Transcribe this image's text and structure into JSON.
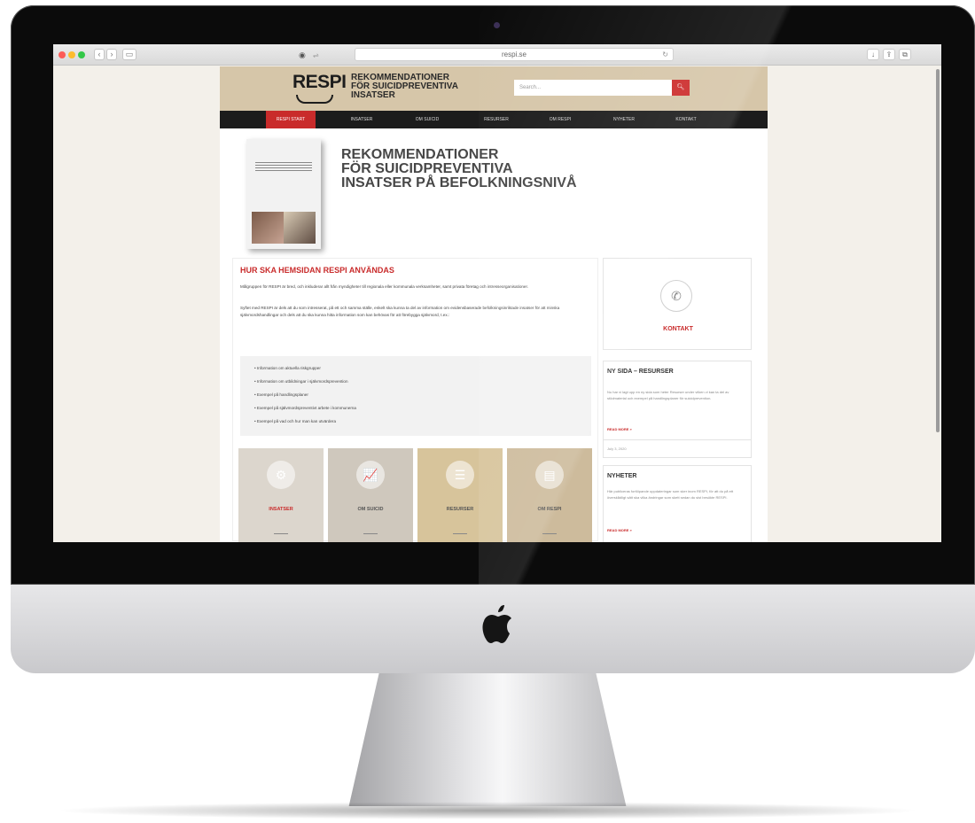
{
  "browser": {
    "url": "respi.se",
    "back_label": "‹",
    "forward_label": "›",
    "sidebar_label": "▭",
    "reload_icon": "↻",
    "share_icon": "⇪",
    "tabs_icon": "⧉",
    "download_icon": "↓"
  },
  "site": {
    "logo": "RESPI",
    "logo_subtitle_1": "REKOMMENDATIONER",
    "logo_subtitle_2": "FÖR SUICIDPREVENTIVA",
    "logo_subtitle_3": "INSATSER",
    "search_placeholder": "Search...",
    "nav": [
      "RESPI START",
      "INSATSER",
      "OM SUICID",
      "RESURSER",
      "OM RESPI",
      "NYHETER",
      "KONTAKT"
    ],
    "hero_title_1": "REKOMMENDATIONER",
    "hero_title_2": "FÖR SUICIDPREVENTIVA",
    "hero_title_3": "INSATSER PÅ BEFOLKNINGSNIVÅ"
  },
  "howto": {
    "title": "HUR SKA HEMSIDAN RESPI ANVÄNDAS",
    "p1": "Målgruppen för RESPI är bred, och inkluderar allt från myndigheter till regionala eller kommunala verksamheter, samt privata företag och intresseorganisationer.",
    "p2": "Syftet med RESPI är dels att du som intresserat, på ett och samma ställe, enkelt ska kunna ta del av information om evidensbaserade befolkningsinriktade insatser för att minska självmordshandlingar och dels att du ska kunna hitta information som kan behövas för att förebygga självmord, t.ex.:",
    "list": [
      "Information om aktuella riskgrupper",
      "Information om utbildningar i självmordsprevention",
      "Exempel på handlingsplaner",
      "Exempel på självmordspreventivt arbete i kommunerna",
      "Exempel på vad och hur man kan utvärdera"
    ]
  },
  "tiles": [
    {
      "label": "INSATSER",
      "icon": "gears-icon",
      "glyph": "⚙",
      "color": "#dcd6cd",
      "label_color": "#c92b2b"
    },
    {
      "label": "OM SUICID",
      "icon": "chart-icon",
      "glyph": "📈",
      "color": "#cfc8bd",
      "label_color": "#555555"
    },
    {
      "label": "RESURSER",
      "icon": "list-icon",
      "glyph": "☰",
      "color": "#d7c49b",
      "label_color": "#555555"
    },
    {
      "label": "OM RESPI",
      "icon": "book-icon",
      "glyph": "▤",
      "color": "#cdbb9c",
      "label_color": "#555555"
    }
  ],
  "sidebar": {
    "kontakt_label": "KONTAKT",
    "posts": [
      {
        "title": "NY SIDA – RESURSER",
        "text": "Nu har vi lagt upp en ny sida som heter Resurser under vilken vi kan ta del av stödmaterial och exempel på handlingsplaner för suicidprevention.",
        "read_more": "READ MORE »",
        "date": "July 3, 2020"
      },
      {
        "title": "NYHETER",
        "text": "Här publiceras fortlöpande uppdateringar som sker inom RESPI, för att du på ett överskådligt sätt ska vilka ändringar som skett sedan du sist besökte RESPI.",
        "read_more": "READ MORE »"
      }
    ]
  },
  "colors": {
    "header_bg": "#d6c6a9",
    "nav_bg": "#1c1c1c",
    "accent_red": "#c92b2b"
  }
}
